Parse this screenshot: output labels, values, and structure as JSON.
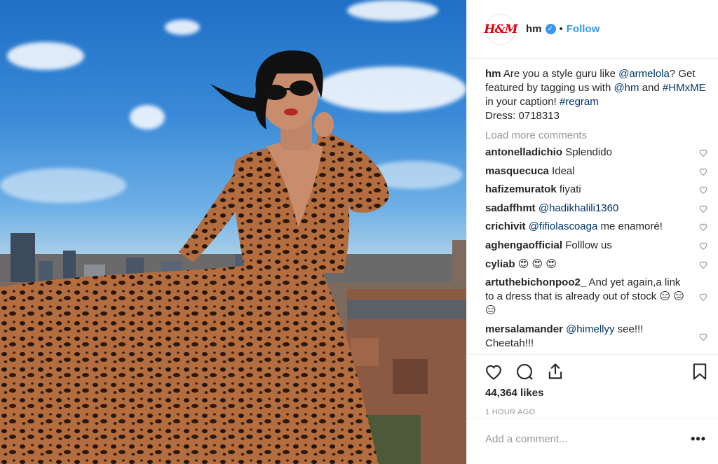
{
  "post": {
    "username": "hm",
    "avatar_text": "H&M",
    "verified": true,
    "separator": "•",
    "follow_label": "Follow"
  },
  "caption": {
    "username": "hm",
    "text_1": "Are you a style guru like ",
    "mention_1": "@armelola",
    "text_2": "? Get featured by tagging us with ",
    "mention_2": "@hm",
    "text_3": " and ",
    "hashtag_1": "#HMxME",
    "text_4": " in your caption! ",
    "hashtag_2": "#regram",
    "text_5": "Dress: 0718313"
  },
  "load_more_label": "Load more comments",
  "comments": [
    {
      "user": "antonelladichio",
      "text": "Splendido"
    },
    {
      "user": "masquecuca",
      "text": "Ideal"
    },
    {
      "user": "hafizemuratok",
      "text": "fiyati"
    },
    {
      "user": "sadaffhmt",
      "text": "",
      "mention": "@hadikhalili1360"
    },
    {
      "user": "crichivit",
      "text": " me enamoré!",
      "mention": "@fifiolascoaga"
    },
    {
      "user": "aghengaofficial",
      "text": "Folllow us"
    },
    {
      "user": "cyliab",
      "text": "😍 😍 😍"
    },
    {
      "user": "artuthebichonpoo2_",
      "text": "And yet again,a link to a dress that is already out of stock 😑 😑 😑"
    },
    {
      "user": "mersalamander",
      "text": " see!!! Cheetah!!!",
      "mention": "@himellyy"
    }
  ],
  "likes": "44,364 likes",
  "timestamp": "1 HOUR AGO",
  "add_comment_placeholder": "Add a comment...",
  "more_options": "•••",
  "colors": {
    "link_blue": "#3897f0",
    "mention_blue": "#003569",
    "text": "#262626",
    "muted": "#999999",
    "hm_red": "#e50010"
  }
}
